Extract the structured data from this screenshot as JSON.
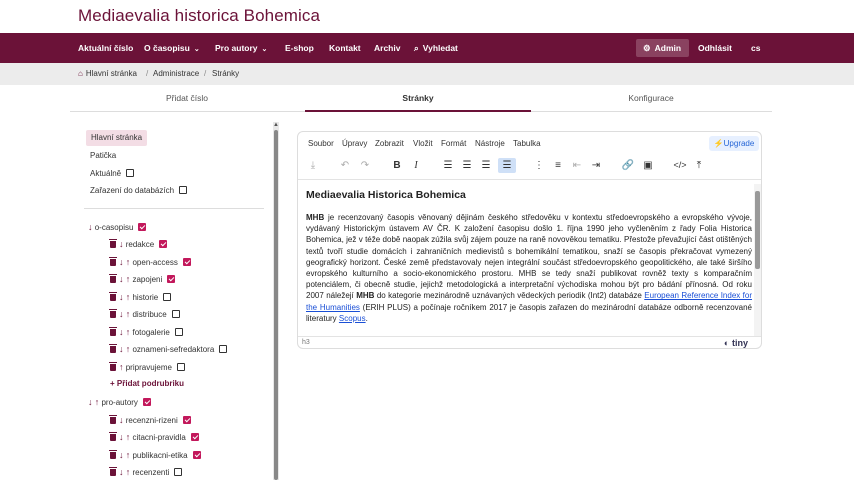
{
  "site": {
    "title": "Mediaevalia historica Bohemica"
  },
  "nav": {
    "items": [
      "Aktuální číslo",
      "O časopisu",
      "Pro autory",
      "E-shop",
      "Kontakt",
      "Archiv",
      "Vyhledat"
    ],
    "admin_label": "Admin",
    "logout_label": "Odhlásit",
    "lang_label": "cs"
  },
  "breadcrumb": {
    "home": "Hlavní stránka",
    "sep": "/",
    "admin": "Administrace",
    "current": "Stránky"
  },
  "tabs": [
    "Přidat číslo",
    "Stránky",
    "Konfigurace"
  ],
  "tree": {
    "top": [
      {
        "label": "Hlavní stránka"
      },
      {
        "label": "Patička"
      },
      {
        "label": "Aktuálně",
        "checked": false
      },
      {
        "label": "Zařazení do databázích",
        "checked": false
      }
    ],
    "sections": [
      {
        "label": "o-casopisu",
        "checked": true,
        "children": [
          {
            "label": "redakce",
            "checked": true
          },
          {
            "label": "open-access",
            "checked": true
          },
          {
            "label": "zapojeni",
            "checked": true
          },
          {
            "label": "historie",
            "checked": false
          },
          {
            "label": "distribuce",
            "checked": false
          },
          {
            "label": "fotogalerie",
            "checked": false
          },
          {
            "label": "oznameni-sefredaktora",
            "checked": false
          },
          {
            "label": "pripravujeme",
            "checked": false
          }
        ],
        "add_label": "Přidat podrubriku"
      },
      {
        "label": "pro-autory",
        "checked": true,
        "children": [
          {
            "label": "recenzni-rizeni",
            "checked": true
          },
          {
            "label": "citacni-pravidla",
            "checked": true
          },
          {
            "label": "publikacni-etika",
            "checked": true
          },
          {
            "label": "recenzenti",
            "checked": false
          }
        ]
      }
    ]
  },
  "editor": {
    "menus": [
      "Soubor",
      "Úpravy",
      "Zobrazit",
      "Vložit",
      "Formát",
      "Nástroje",
      "Tabulka"
    ],
    "upgrade_label": "Upgrade",
    "heading": "Mediaevalia Historica Bohemica",
    "p1": "je recenzovaný časopis věnovaný dějinám českého středověku v kontextu středoevropského a evropského vývoje, vydávaný Historickým ústavem AV ČR. K založení časopisu došlo 1. října 1990 jeho vyčleněním z řady Folia Historica Bohemica, jež v téže době naopak zúžila svůj zájem pouze na raně novověkou tematiku. Přestože převažující část otištěných textů tvoří studie domácích i zahraničních medievistů s bohemikální tematikou, snaží se časopis překračovat vymezený geografický horizont. České země představovaly nejen integrální součást středoevropského geopolitického, ale také širšího evropského kulturního a socio-ekonomického prostoru. MHB se tedy snaží publikovat rovněž texty s komparačním potenciálem, či obecně studie, jejichž metodologická a interpretační východiska mohou být pro bádání přínosná. Od roku 2007 náležejí",
    "p1_bold_start": "MHB",
    "p1_bold_mid": "MHB",
    "p1_cont": "do kategorie mezinárodně uznávaných vědeckých periodik (Int2) databáze",
    "link1": "European Reference Index for the Humanities",
    "p1_cont2": "(ERIH PLUS) a počínaje ročníkem 2017 je časopis zařazen do mezinárodní databáze odborně recenzované literatury",
    "link2": "Scopus",
    "status_path": "h3",
    "brand": "tiny"
  }
}
